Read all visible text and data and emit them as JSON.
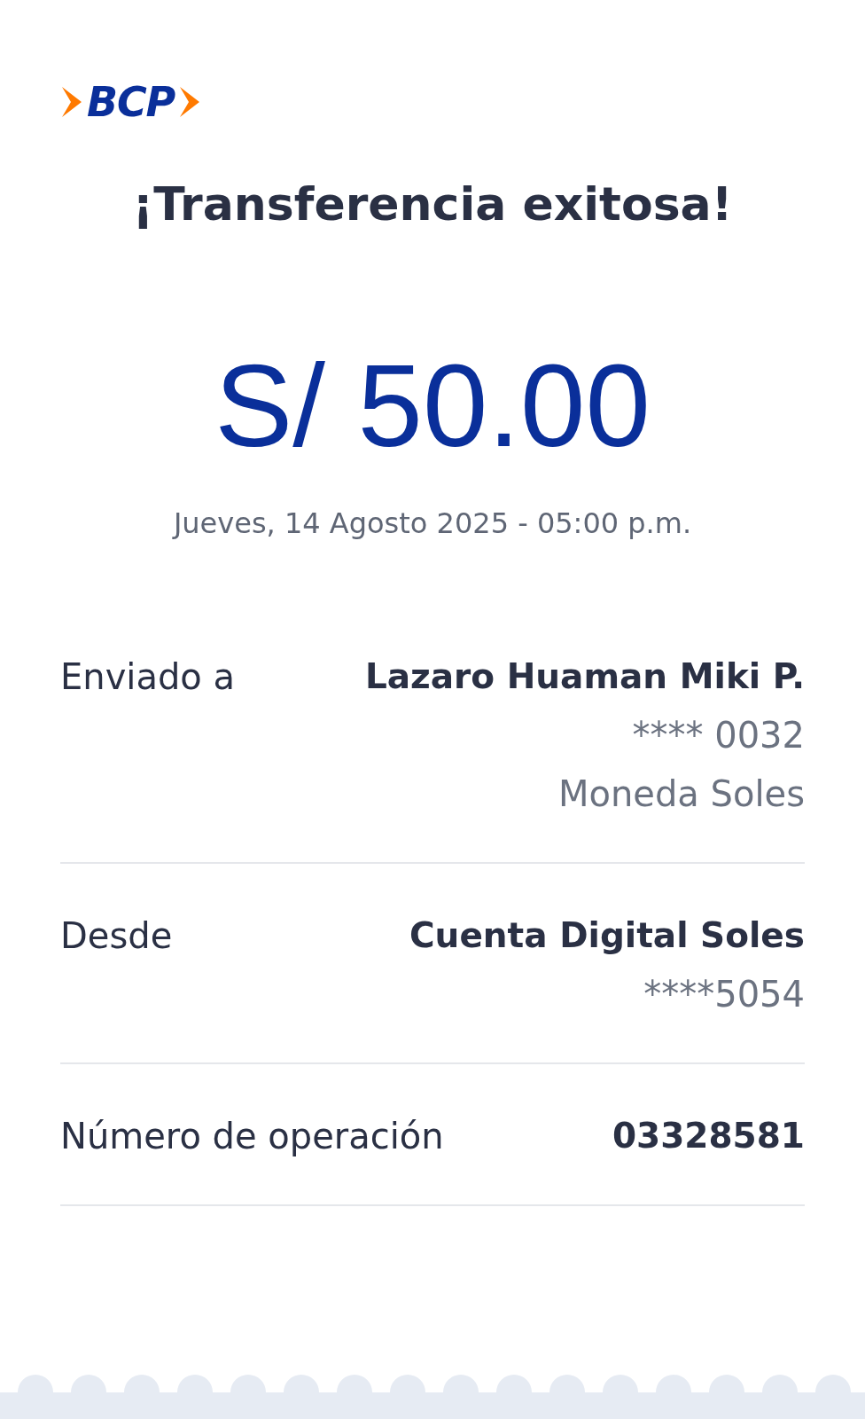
{
  "logo": {
    "text": "BCP"
  },
  "title": "¡Transferencia exitosa!",
  "amount": "S/ 50.00",
  "datetime": "Jueves, 14 Agosto 2025 - 05:00 p.m.",
  "details": [
    {
      "label": "Enviado a",
      "value": "Lazaro Huaman Miki P.",
      "sublines": [
        "**** 0032",
        "Moneda Soles"
      ]
    },
    {
      "label": "Desde",
      "value": "Cuenta Digital Soles",
      "sublines": [
        "****5054"
      ]
    },
    {
      "label": "Número de operación",
      "value": "03328581"
    }
  ]
}
